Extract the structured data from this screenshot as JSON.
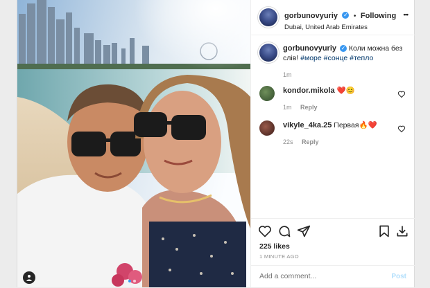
{
  "post": {
    "username": "gorbunovyuriy",
    "follow_separator": "•",
    "follow_label": "Following",
    "location": "Dubai, United Arab Emirates",
    "more_label": "•••",
    "caption_text": "Коли можна без слів!",
    "caption_tags": [
      "#море",
      "#сонце",
      "#тепло"
    ],
    "caption_time": "1m",
    "likes": "225 likes",
    "timestamp": "1 MINUTE AGO",
    "add_comment_placeholder": "Add a comment...",
    "post_label": "Post"
  },
  "comments": [
    {
      "user": "kondor.mikola",
      "text": "❤️😊",
      "time": "1m",
      "reply": "Reply"
    },
    {
      "user": "vikyle_4ka.25",
      "text": "Первая🔥❤️",
      "time": "22s",
      "reply": "Reply"
    }
  ],
  "colors": {
    "accent": "#3897f0",
    "tag": "#00376b",
    "muted": "#8e8e8e"
  }
}
